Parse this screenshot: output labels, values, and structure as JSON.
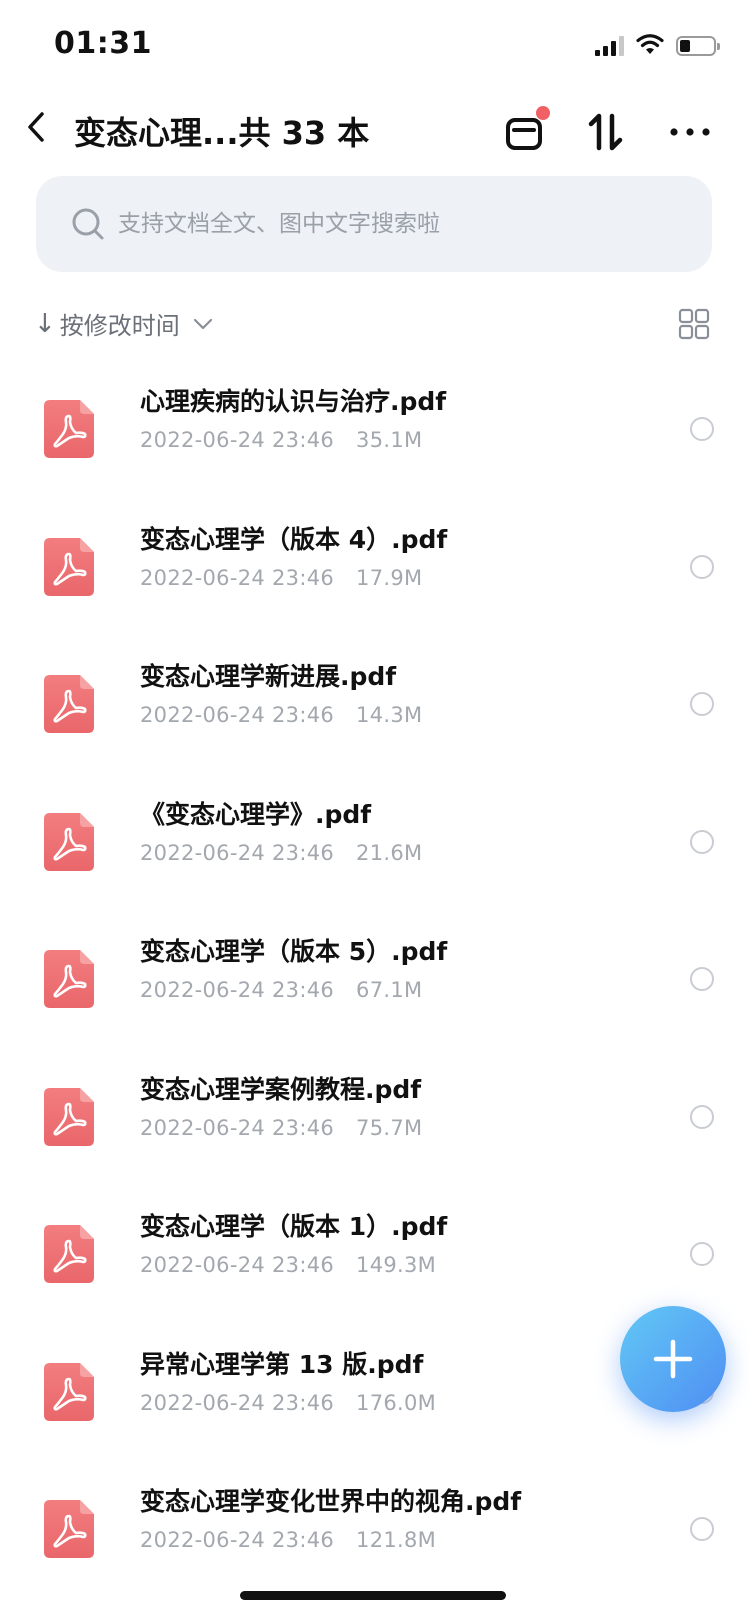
{
  "status_bar": {
    "time": "01:31",
    "battery_level": 0.4
  },
  "header": {
    "back_icon": "chevron-left-icon",
    "title": "变态心理...共 33 本",
    "actions": [
      {
        "icon": "basket-icon",
        "badge_color": "#f06065"
      },
      {
        "icon": "sort-arrows-icon"
      },
      {
        "icon": "more-icon"
      }
    ]
  },
  "search": {
    "placeholder": "支持文档全文、图中文字搜索啦"
  },
  "sort": {
    "label": "按修改时间",
    "direction_icon": "↓",
    "view_toggle_icon": "grid-view-icon"
  },
  "files": [
    {
      "name": "心理疾病的认识与治疗.pdf",
      "date": "2022-06-24 23:46",
      "size": "35.1M"
    },
    {
      "name": "变态心理学（版本 4）.pdf",
      "date": "2022-06-24 23:46",
      "size": "17.9M"
    },
    {
      "name": "变态心理学新进展.pdf",
      "date": "2022-06-24 23:46",
      "size": "14.3M"
    },
    {
      "name": "《变态心理学》.pdf",
      "date": "2022-06-24 23:46",
      "size": "21.6M"
    },
    {
      "name": "变态心理学（版本 5）.pdf",
      "date": "2022-06-24 23:46",
      "size": "67.1M"
    },
    {
      "name": "变态心理学案例教程.pdf",
      "date": "2022-06-24 23:46",
      "size": "75.7M"
    },
    {
      "name": "变态心理学（版本 1）.pdf",
      "date": "2022-06-24 23:46",
      "size": "149.3M"
    },
    {
      "name": "异常心理学第 13 版.pdf",
      "date": "2022-06-24 23:46",
      "size": "176.0M"
    },
    {
      "name": "变态心理学变化世界中的视角.pdf",
      "date": "2022-06-24 23:46",
      "size": "121.8M"
    }
  ],
  "fab": {
    "icon": "plus-icon",
    "gradient": [
      "#62c8f5",
      "#4f8ef3"
    ]
  },
  "colors": {
    "pdf_icon": "#ef6f72",
    "meta_text": "#a3a7ae",
    "search_bg": "#eef1f6"
  }
}
